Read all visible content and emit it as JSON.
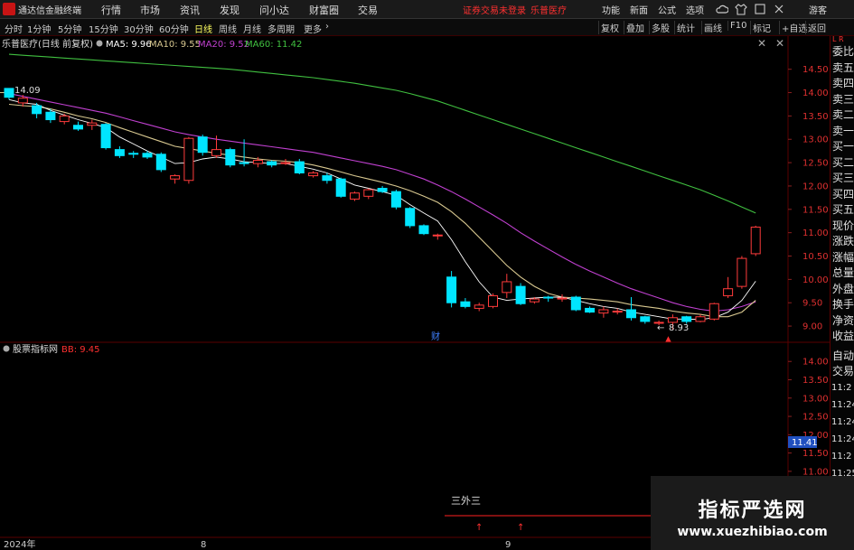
{
  "app": {
    "title": "通达信金融终端"
  },
  "menu": [
    "行情",
    "市场",
    "资讯",
    "发现",
    "问小达",
    "财富圈",
    "交易"
  ],
  "notice": "证券交易未登录",
  "stock_name": "乐普医疗",
  "menu_right": [
    "功能",
    "新面",
    "公式",
    "选项",
    "游客"
  ],
  "timeframes": [
    "分时",
    "1分钟",
    "5分钟",
    "15分钟",
    "30分钟",
    "60分钟",
    "日线",
    "周线",
    "月线",
    "多周期",
    "更多"
  ],
  "toolbar_right": [
    "复权",
    "叠加",
    "多股",
    "统计",
    "画线",
    "F10",
    "标记",
    "+自选",
    "返回"
  ],
  "legend": {
    "title": "乐普医疗(日线 前复权)",
    "ma5": "MA5: 9.96",
    "ma10": "MA10: 9.55",
    "ma20": "MA20: 9.52",
    "ma60": "MA60: 11.42"
  },
  "markers": {
    "high": "14.09",
    "low": "8.93",
    "fin_badge": "财",
    "sub_label": "三外三"
  },
  "sub_indicator": {
    "name": "股票指标网",
    "bb": "BB: 9.45",
    "current": "11.41"
  },
  "x_labels": [
    "2024年",
    "8",
    "9"
  ],
  "right_panel": {
    "labels": [
      "委比",
      "卖五",
      "卖四",
      "卖三",
      "卖二",
      "卖一",
      "买一",
      "买二",
      "买三",
      "买四",
      "买五",
      "现价",
      "涨跌",
      "涨幅",
      "总量",
      "外盘",
      "换手",
      "净资",
      "收益"
    ],
    "lower": [
      "自动",
      "交易"
    ],
    "times": [
      "11:2",
      "11:24",
      "11:24",
      "11:24",
      "11:2",
      "11:25",
      "11:25",
      "11:25",
      "11:25"
    ],
    "corner": "L R"
  },
  "watermark": {
    "title": "指标严选网",
    "url": "www.xuezhibiao.com"
  },
  "colors": {
    "up": "#ff3b3b",
    "down": "#00e5ff",
    "ma5": "#ffffff",
    "ma10": "#d8c890",
    "ma20": "#c040d0",
    "ma60": "#40c040",
    "accent": "#ff3030"
  },
  "chart_data": {
    "type": "candlestick",
    "main_axis": {
      "ticks": [
        14.5,
        14.0,
        13.5,
        13.0,
        12.5,
        12.0,
        11.5,
        11.0,
        10.5,
        10.0,
        9.5,
        9.0
      ],
      "range": [
        8.75,
        14.9
      ]
    },
    "sub_axis": {
      "ticks": [
        14.0,
        13.5,
        13.0,
        12.5,
        12.0,
        11.5,
        11.0
      ],
      "range": [
        10.8,
        14.4
      ]
    },
    "candles": [
      [
        14.09,
        13.9,
        14.09,
        13.85
      ],
      [
        13.78,
        13.88,
        13.95,
        13.7
      ],
      [
        13.72,
        13.55,
        13.78,
        13.45
      ],
      [
        13.58,
        13.42,
        13.65,
        13.35
      ],
      [
        13.38,
        13.5,
        13.55,
        13.32
      ],
      [
        13.3,
        13.22,
        13.38,
        13.18
      ],
      [
        13.3,
        13.35,
        13.42,
        13.2
      ],
      [
        13.32,
        12.82,
        13.35,
        12.78
      ],
      [
        12.78,
        12.65,
        12.85,
        12.6
      ],
      [
        12.7,
        12.68,
        12.75,
        12.6
      ],
      [
        12.7,
        12.62,
        12.75,
        12.58
      ],
      [
        12.68,
        12.35,
        12.72,
        12.3
      ],
      [
        12.15,
        12.22,
        12.25,
        12.05
      ],
      [
        12.12,
        13.02,
        13.05,
        12.05
      ],
      [
        13.05,
        12.72,
        13.1,
        12.65
      ],
      [
        12.65,
        12.78,
        13.08,
        12.6
      ],
      [
        12.78,
        12.45,
        12.82,
        12.4
      ],
      [
        12.5,
        12.48,
        13.0,
        12.42
      ],
      [
        12.48,
        12.55,
        12.62,
        12.4
      ],
      [
        12.52,
        12.45,
        12.55,
        12.4
      ],
      [
        12.48,
        12.5,
        12.58,
        12.45
      ],
      [
        12.52,
        12.28,
        12.58,
        12.25
      ],
      [
        12.22,
        12.28,
        12.32,
        12.18
      ],
      [
        12.22,
        12.12,
        12.28,
        12.05
      ],
      [
        12.15,
        11.78,
        12.18,
        11.75
      ],
      [
        11.72,
        11.85,
        11.88,
        11.68
      ],
      [
        11.78,
        11.92,
        11.95,
        11.72
      ],
      [
        11.95,
        11.88,
        12.0,
        11.85
      ],
      [
        11.88,
        11.55,
        11.92,
        11.5
      ],
      [
        11.52,
        11.15,
        11.55,
        11.1
      ],
      [
        11.15,
        10.98,
        11.18,
        10.95
      ],
      [
        10.95,
        10.95,
        10.98,
        10.85
      ],
      [
        10.05,
        9.5,
        10.18,
        9.4
      ],
      [
        9.52,
        9.42,
        9.6,
        9.38
      ],
      [
        9.38,
        9.45,
        9.5,
        9.32
      ],
      [
        9.42,
        9.65,
        9.7,
        9.38
      ],
      [
        9.72,
        9.95,
        10.12,
        9.6
      ],
      [
        9.85,
        9.48,
        9.92,
        9.45
      ],
      [
        9.52,
        9.58,
        9.62,
        9.48
      ],
      [
        9.62,
        9.6,
        9.65,
        9.52
      ],
      [
        9.58,
        9.6,
        9.68,
        9.52
      ],
      [
        9.62,
        9.35,
        9.65,
        9.32
      ],
      [
        9.38,
        9.3,
        9.42,
        9.28
      ],
      [
        9.28,
        9.35,
        9.42,
        9.18
      ],
      [
        9.32,
        9.32,
        9.38,
        9.25
      ],
      [
        9.35,
        9.18,
        9.62,
        9.12
      ],
      [
        9.2,
        9.1,
        9.22,
        9.05
      ],
      [
        9.08,
        9.08,
        9.12,
        9.02
      ],
      [
        9.08,
        9.18,
        9.25,
        8.93
      ],
      [
        9.2,
        9.1,
        9.22,
        9.05
      ],
      [
        9.1,
        9.2,
        9.25,
        9.08
      ],
      [
        9.15,
        9.48,
        9.5,
        9.12
      ],
      [
        9.65,
        9.8,
        10.05,
        9.6
      ],
      [
        9.85,
        10.45,
        10.5,
        9.8
      ],
      [
        10.55,
        11.12,
        11.15,
        10.5
      ]
    ],
    "ma5": [
      13.85,
      13.78,
      13.75,
      13.62,
      13.52,
      13.42,
      13.34,
      13.25,
      13.05,
      12.9,
      12.75,
      12.62,
      12.48,
      12.5,
      12.58,
      12.62,
      12.58,
      12.52,
      12.5,
      12.48,
      12.48,
      12.42,
      12.36,
      12.28,
      12.15,
      12.02,
      11.95,
      11.88,
      11.8,
      11.6,
      11.42,
      11.25,
      10.85,
      10.38,
      9.95,
      9.62,
      9.55,
      9.58,
      9.6,
      9.62,
      9.62,
      9.55,
      9.48,
      9.42,
      9.38,
      9.3,
      9.25,
      9.2,
      9.15,
      9.15,
      9.14,
      9.18,
      9.3,
      9.55,
      9.96
    ],
    "ma10": [
      13.75,
      13.72,
      13.7,
      13.65,
      13.58,
      13.5,
      13.44,
      13.36,
      13.25,
      13.15,
      13.05,
      12.95,
      12.85,
      12.8,
      12.75,
      12.7,
      12.66,
      12.62,
      12.58,
      12.55,
      12.53,
      12.5,
      12.45,
      12.38,
      12.3,
      12.22,
      12.15,
      12.08,
      12.0,
      11.9,
      11.78,
      11.65,
      11.45,
      11.2,
      10.9,
      10.6,
      10.3,
      10.05,
      9.85,
      9.7,
      9.62,
      9.6,
      9.58,
      9.55,
      9.52,
      9.46,
      9.42,
      9.38,
      9.32,
      9.28,
      9.25,
      9.2,
      9.2,
      9.3,
      9.55
    ],
    "ma20": [
      13.98,
      13.92,
      13.86,
      13.8,
      13.74,
      13.68,
      13.62,
      13.56,
      13.48,
      13.4,
      13.32,
      13.24,
      13.16,
      13.1,
      13.05,
      13.0,
      12.96,
      12.92,
      12.88,
      12.84,
      12.8,
      12.76,
      12.72,
      12.66,
      12.6,
      12.54,
      12.48,
      12.42,
      12.35,
      12.25,
      12.15,
      12.02,
      11.88,
      11.72,
      11.55,
      11.38,
      11.2,
      11.0,
      10.82,
      10.65,
      10.48,
      10.32,
      10.18,
      10.05,
      9.92,
      9.8,
      9.7,
      9.6,
      9.5,
      9.42,
      9.36,
      9.32,
      9.35,
      9.42,
      9.52
    ],
    "ma60": [
      14.82,
      14.8,
      14.78,
      14.76,
      14.74,
      14.72,
      14.7,
      14.68,
      14.66,
      14.64,
      14.62,
      14.6,
      14.58,
      14.56,
      14.54,
      14.52,
      14.5,
      14.47,
      14.44,
      14.41,
      14.38,
      14.35,
      14.32,
      14.28,
      14.24,
      14.2,
      14.15,
      14.1,
      14.05,
      13.98,
      13.9,
      13.82,
      13.72,
      13.62,
      13.52,
      13.42,
      13.32,
      13.22,
      13.12,
      13.02,
      12.92,
      12.82,
      12.72,
      12.62,
      12.52,
      12.42,
      12.32,
      12.22,
      12.12,
      12.02,
      11.92,
      11.8,
      11.68,
      11.55,
      11.42
    ]
  }
}
